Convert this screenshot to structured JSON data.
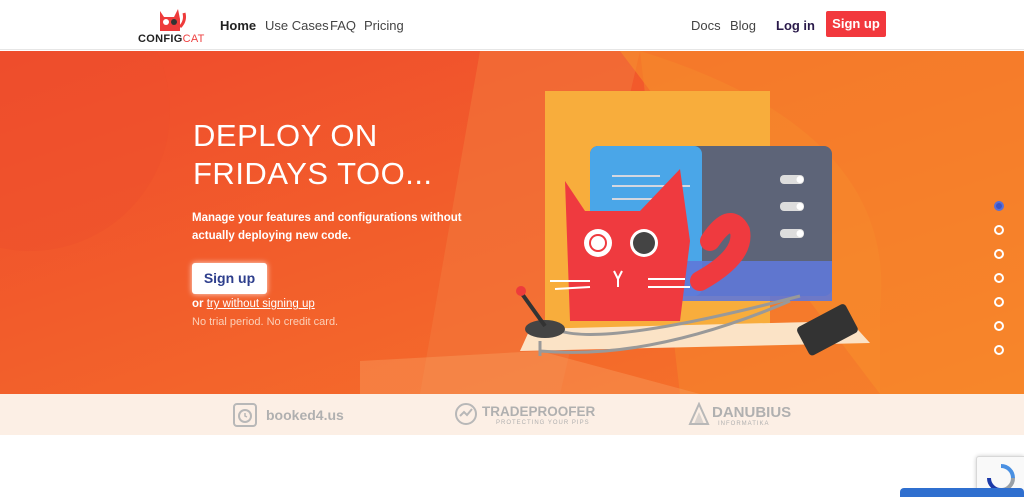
{
  "header": {
    "logo_text_main": "CONFIG",
    "logo_text_accent": "CAT",
    "nav": [
      "Home",
      "Use Cases",
      "FAQ",
      "Pricing"
    ],
    "right_nav": [
      "Docs",
      "Blog"
    ],
    "login_label": "Log in",
    "signup_label": "Sign up"
  },
  "hero": {
    "title_line1": "DEPLOY ON",
    "title_line2": "FRIDAYS TOO...",
    "subtitle_line1": "Manage your features and configurations without",
    "subtitle_line2": "actually deploying new code.",
    "signup_button": "Sign up",
    "or_label": "or",
    "try_link": "try without signing up",
    "note": "No trial period. No credit card.",
    "slide_count": 7,
    "active_slide": 1
  },
  "clients": [
    {
      "name": "booked4.us",
      "icon": "calendar-icon"
    },
    {
      "name": "TRADEPROOFER",
      "tagline": "PROTECTING YOUR PIPS",
      "icon": "chart-shield-icon"
    },
    {
      "name": "DANUBIUS",
      "tagline": "INFORMATIKA",
      "icon": "mountain-icon"
    }
  ],
  "colors": {
    "brand_red": "#f2383d",
    "hero_orange": "#f0602c",
    "signup_text_blue": "#2d3e8c",
    "active_dot": "#3b54c6"
  }
}
